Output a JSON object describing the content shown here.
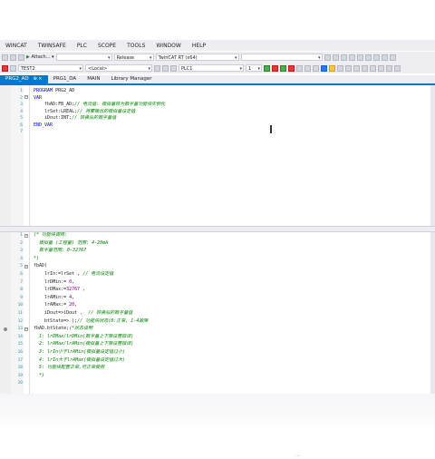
{
  "menu": [
    "WINCAT",
    "TWINSAFE",
    "PLC",
    "SCOPE",
    "TOOLS",
    "WINDOW",
    "HELP"
  ],
  "toolbar1": {
    "attach_label": "Attach...",
    "config_value": "Release",
    "platform_value": "TwinCAT RT (x64)"
  },
  "toolbar2": {
    "project_value": "TEST2",
    "target_value": "<Local>",
    "plc_value": "PLC1",
    "number_value": "1"
  },
  "tabs": [
    {
      "label": "PRG2_AD",
      "pin": "⊕ ×",
      "active": true
    },
    {
      "label": "PRG1_DA",
      "pin": "",
      "active": false
    },
    {
      "label": "MAIN",
      "pin": "",
      "active": false
    },
    {
      "label": "Library Manager",
      "pin": "",
      "active": false
    }
  ],
  "declaration": {
    "line_numbers": [
      "1",
      "2",
      "3",
      "4",
      "5",
      "6",
      "7"
    ],
    "lines": [
      {
        "kw": "PROGRAM",
        "rest": " PRG2_AD",
        "comment": ""
      },
      {
        "kw": "VAR",
        "rest": "",
        "comment": ""
      },
      {
        "kw": "",
        "rest": "    fbAD:FB_AD;",
        "comment": "// 电流值: 模拟量转为数字量功能块实例化"
      },
      {
        "kw": "",
        "rest": "    lrSet:LREAL;",
        "comment": "// 将要输出的模拟量设定值"
      },
      {
        "kw": "",
        "rest": "    iDout:INT;",
        "comment": "// 转换后的数字量值"
      },
      {
        "kw": "END_VAR",
        "rest": "",
        "comment": ""
      },
      {
        "kw": "",
        "rest": "",
        "comment": ""
      }
    ]
  },
  "implementation": {
    "line_numbers": [
      "1",
      "2",
      "3",
      "4",
      "5",
      "6",
      "7",
      "8",
      "9",
      "10",
      "11",
      "12",
      "13",
      "14",
      "15",
      "16",
      "17",
      "18",
      "19",
      "20"
    ],
    "lines": [
      "(* 功能块调用:",
      "  模拟量 (工程量) 范围: 4-20mA",
      "  数字量范围: 0-32767",
      "*)",
      "fbAD(",
      "    lrIn:=lrSet , // 电流设定值",
      "    lrDMin:= 0,",
      "    lrDMax:=32767 ,",
      "    lrAMin:= 4,",
      "    lrAMax:= 20,",
      "    iDout=>iDout ,  // 转换后的数字量值",
      "    btState=> );// 功能块状态(0:正常, 1-4故障",
      "fbAD.btState;(*状态说明",
      "  1: lrDMax/lrDMin(数字量上下限设置错误)",
      "  2: lrAMax/lrAMin(模拟量上下限设置错误)",
      "  3: lrIn小于lrAMin(模拟量设定值过小)",
      "  4: lrIn大于lrAMax(模拟量设定值过大)",
      "  5: 功能块配置正常,可正常使用",
      "  *)",
      ""
    ]
  }
}
